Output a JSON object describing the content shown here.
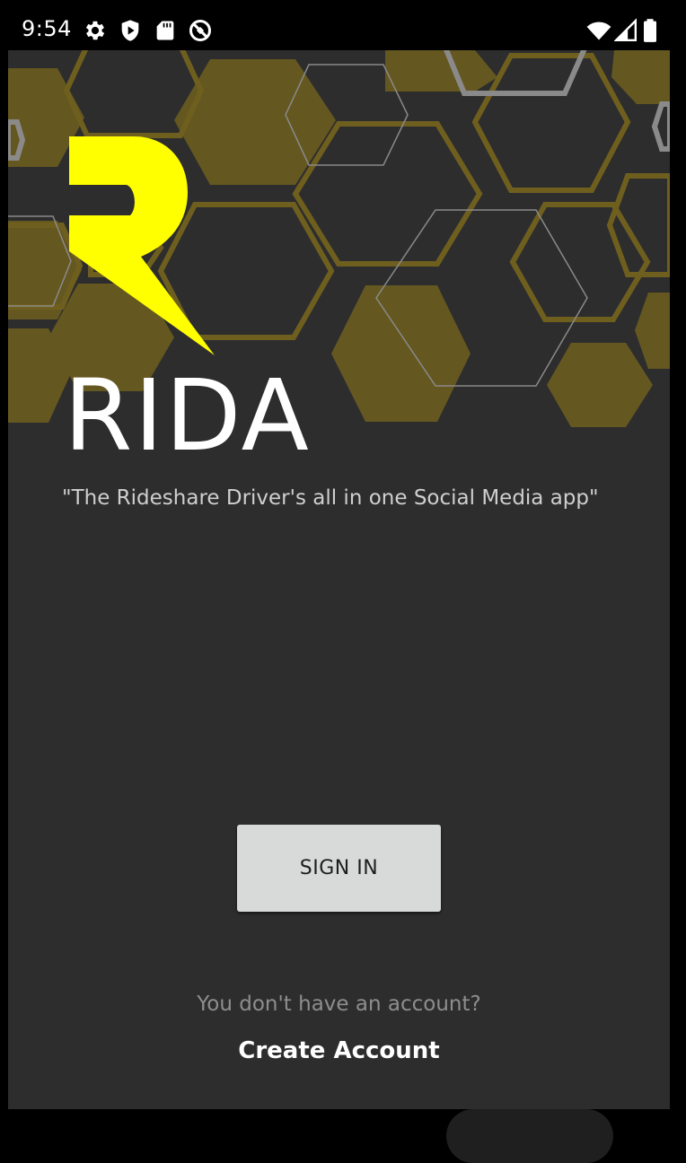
{
  "status_bar": {
    "time": "9:54",
    "left_icons": [
      "gear-icon",
      "shield-play-icon",
      "sd-card-icon",
      "do-not-disturb-icon"
    ],
    "right_icons": [
      "wifi-icon",
      "cell-signal-icon",
      "battery-icon"
    ]
  },
  "app": {
    "title": "RIDA",
    "tagline": "\"The Rideshare Driver's all in one Social Media app\"",
    "sign_in_label": "SIGN IN",
    "no_account_text": "You don't have an account?",
    "create_account_label": "Create Account"
  },
  "colors": {
    "background": "#2d2d2d",
    "logo": "#ffff00",
    "hex_gold": "#7a6a1e",
    "button": "#d8d9d9"
  }
}
